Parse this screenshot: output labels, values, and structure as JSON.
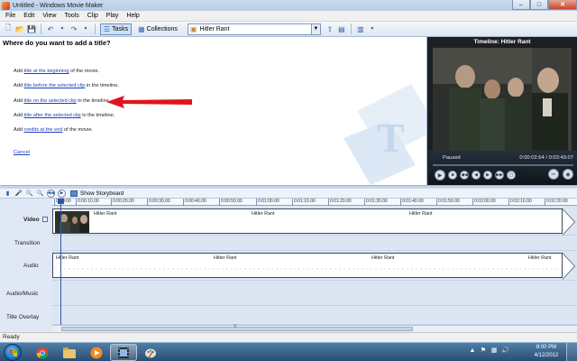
{
  "window": {
    "title": "Untitled - Windows Movie Maker",
    "minimize": "–",
    "maximize": "□",
    "close": "✕"
  },
  "menu": [
    "File",
    "Edit",
    "View",
    "Tools",
    "Clip",
    "Play",
    "Help"
  ],
  "toolbar": {
    "tasks_label": "Tasks",
    "collections_label": "Collections",
    "collection_value": "Hitler Rant"
  },
  "tasks": {
    "heading": "Where do you want to add a title?",
    "items": [
      {
        "prefix": "Add ",
        "link": "title at the beginning",
        "suffix": " of the movie."
      },
      {
        "prefix": "Add ",
        "link": "title before the selected clip",
        "suffix": " in the timeline."
      },
      {
        "prefix": "Add ",
        "link": "title on the selected clip",
        "suffix": " in the timeline."
      },
      {
        "prefix": "Add ",
        "link": "title after the selected clip",
        "suffix": " in the timeline."
      },
      {
        "prefix": "Add ",
        "link": "credits at the end",
        "suffix": " of the movie."
      }
    ],
    "cancel": "Cancel"
  },
  "preview": {
    "title": "Timeline: Hitler Rant",
    "status": "Paused",
    "time": "0:00:02.64 / 0:03:49.07"
  },
  "timeline": {
    "show_storyboard": "Show Storyboard",
    "ruler": [
      "0:00:00",
      "0:00:10.00",
      "0:00:20.00",
      "0:00:30.00",
      "0:00:40.00",
      "0:00:50.00",
      "0:01:00.00",
      "0:01:10.00",
      "0:01:20.00",
      "0:01:30.00",
      "0:01:40.00",
      "0:01:50.00",
      "0:02:00.00",
      "0:02:10.00",
      "0:02:20.00"
    ],
    "tracks": {
      "video": "Video",
      "transition": "Transition",
      "audio": "Audio",
      "audio_music": "Audio/Music",
      "title_overlay": "Title Overlay"
    },
    "video_clip_labels": [
      "Hitler Rant",
      "Hitler Rant",
      "Hitler Rant"
    ],
    "audio_clip_labels": [
      "Hitler Rant",
      "Hitler Rant",
      "Hitler Rant",
      "Hitler Rant"
    ]
  },
  "status_bar": "Ready",
  "taskbar": {
    "time": "8:00 PM",
    "date": "4/12/2012"
  },
  "colors": {
    "arrow": "#e0141c",
    "link": "#1d3fbf",
    "playhead": "#2b56a8"
  }
}
